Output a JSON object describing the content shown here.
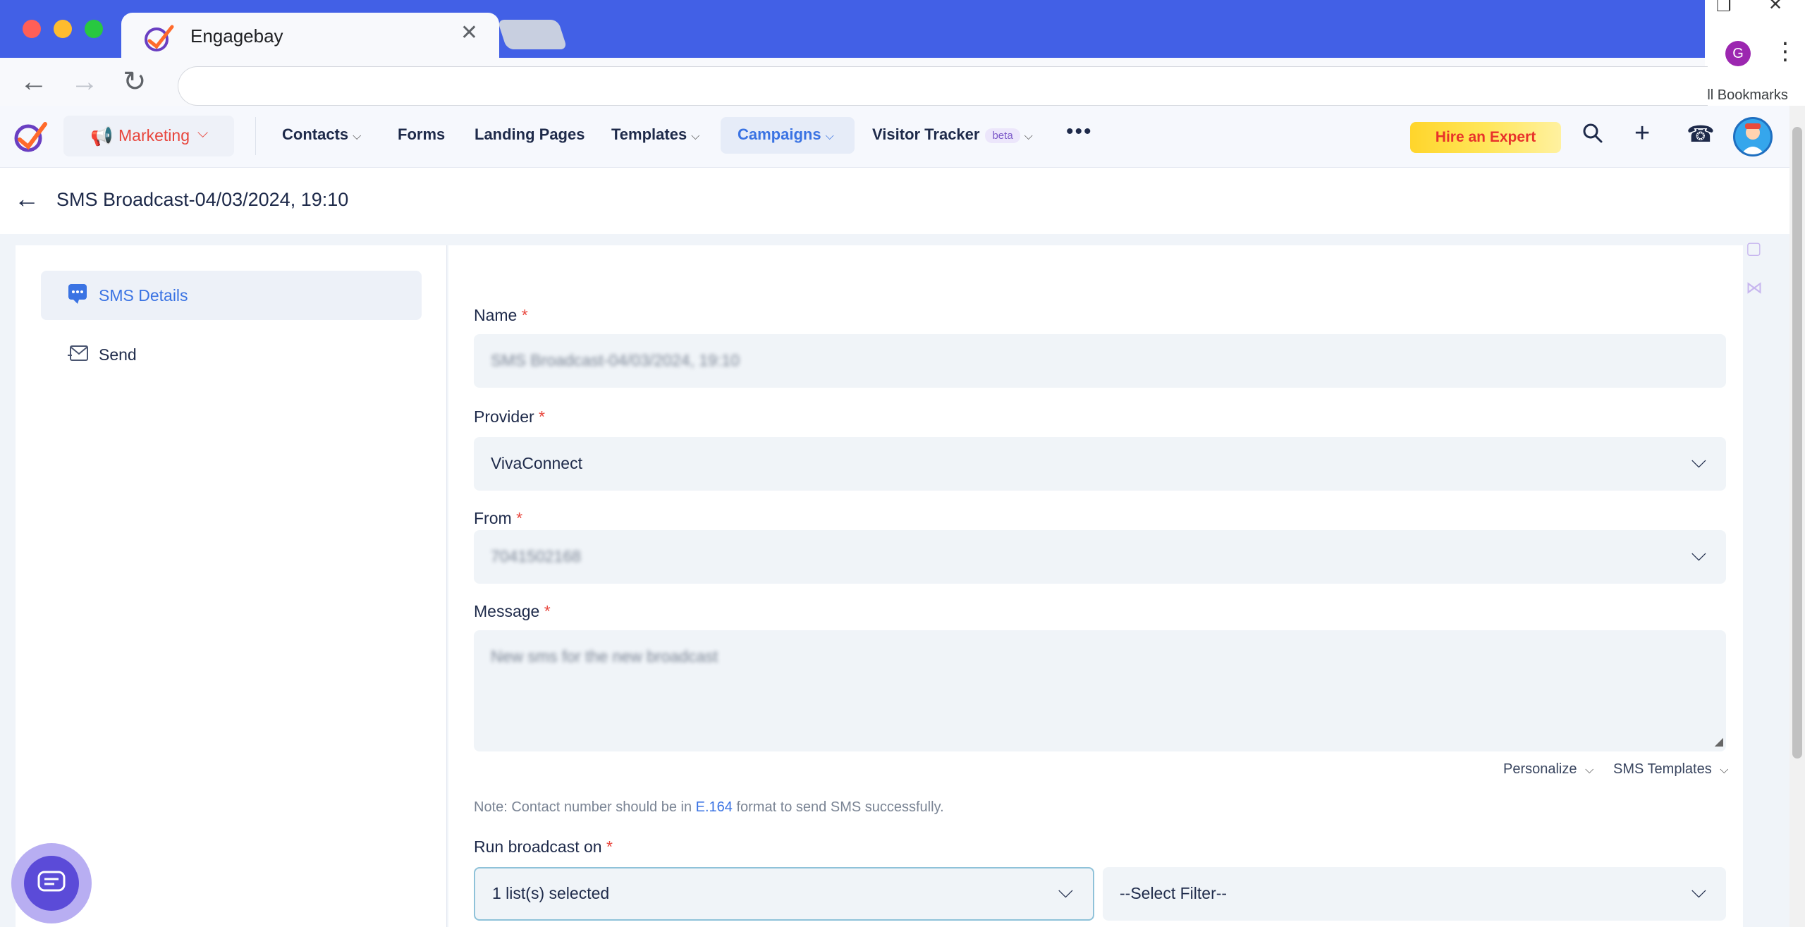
{
  "browser": {
    "tab_title": "Engagebay",
    "tab_close": "✕",
    "profile_initial": "G",
    "bookmarks_label": "All Bookmarks"
  },
  "nav": {
    "marketing": "Marketing",
    "contacts": "Contacts",
    "forms": "Forms",
    "landing_pages": "Landing Pages",
    "templates": "Templates",
    "campaigns": "Campaigns",
    "visitor_tracker": "Visitor Tracker",
    "beta": "beta",
    "more": "•••",
    "hire_expert": "Hire an Expert"
  },
  "page": {
    "title": "SMS Broadcast-04/03/2024, 19:10"
  },
  "sidebar": {
    "items": [
      {
        "label": "SMS Details",
        "active": true
      },
      {
        "label": "Send",
        "active": false
      }
    ]
  },
  "form": {
    "name_label": "Name",
    "name_value": "SMS Broadcast-04/03/2024, 19:10",
    "provider_label": "Provider",
    "provider_value": "VivaConnect",
    "from_label": "From",
    "from_value": "7041502168",
    "message_label": "Message",
    "message_value": "New sms for the new broadcast",
    "required_mark": "*",
    "personalize": "Personalize",
    "sms_templates": "SMS Templates",
    "note_prefix": "Note: Contact number should be in ",
    "note_link": "E.164",
    "note_suffix": " format to send SMS successfully.",
    "run_label": "Run broadcast on",
    "list_value": "1 list(s) selected",
    "filter_value": "--Select Filter--"
  },
  "colors": {
    "tabbar": "#4260e6",
    "accent": "#3a73e3",
    "marketing": "#e8453c",
    "hire_text": "#e8312b"
  }
}
